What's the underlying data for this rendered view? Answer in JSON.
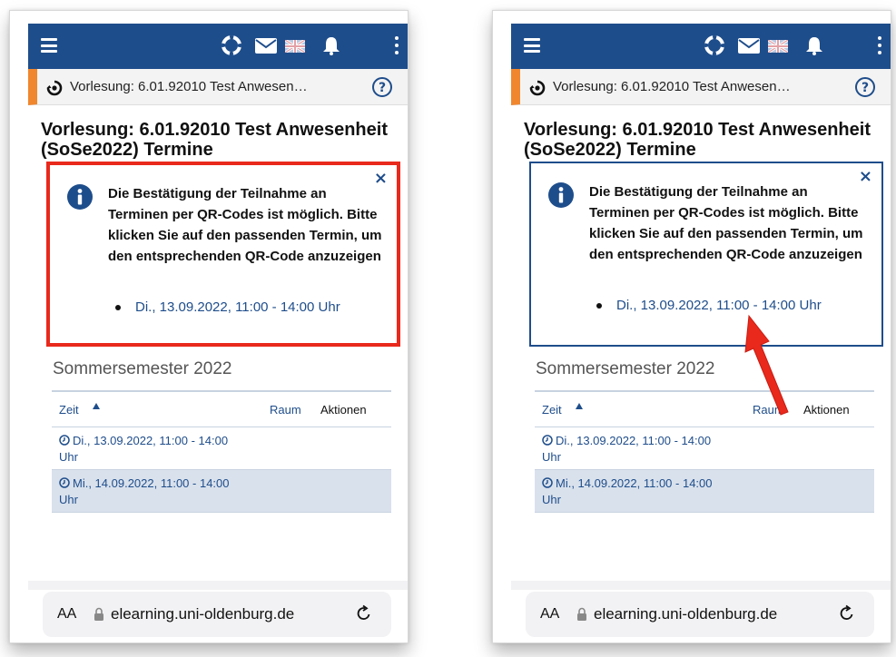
{
  "colors": {
    "brand_blue": "#1e4d8b",
    "accent_orange": "#f0872e",
    "highlight_red": "#e8291c",
    "row_alt": "#d9e1ec"
  },
  "panels": [
    {
      "breadcrumb": "Vorlesung: 6.01.92010 Test Anwesen…",
      "title": "Vorlesung: 6.01.92010 Test Anwesenheit (SoSe2022) Termine",
      "info": {
        "message": "Die Bestätigung der Teilnahme an Terminen per QR-Codes ist möglich. Bitte klicken Sie auf den passenden Termin, um den entsprechenden QR-Code anzuzeigen",
        "appointment": "Di., 13.09.2022, 11:00 - 14:00 Uhr",
        "close": "×"
      },
      "semester": "Sommersemester 2022",
      "table": {
        "headers": {
          "time": "Zeit",
          "room": "Raum",
          "actions": "Aktionen"
        },
        "rows": [
          {
            "time": "Di., 13.09.2022, 11:00 - 14:00 Uhr"
          },
          {
            "time": "Mi., 14.09.2022, 11:00 - 14:00 Uhr"
          }
        ]
      },
      "urlbar": {
        "aa": "AA",
        "domain": "elearning.uni-oldenburg.de"
      }
    },
    {
      "breadcrumb": "Vorlesung: 6.01.92010 Test Anwesen…",
      "title": "Vorlesung: 6.01.92010 Test Anwesenheit (SoSe2022) Termine",
      "info": {
        "message": "Die Bestätigung der Teilnahme an Terminen per QR-Codes ist möglich. Bitte klicken Sie auf den passenden Termin, um den entsprechenden QR-Code anzuzeigen",
        "appointment": "Di., 13.09.2022, 11:00 - 14:00 Uhr",
        "close": "×"
      },
      "semester": "Sommersemester 2022",
      "table": {
        "headers": {
          "time": "Zeit",
          "room": "Raum",
          "actions": "Aktionen"
        },
        "rows": [
          {
            "time": "Di., 13.09.2022, 11:00 - 14:00 Uhr"
          },
          {
            "time": "Mi., 14.09.2022, 11:00 - 14:00 Uhr"
          }
        ]
      },
      "urlbar": {
        "aa": "AA",
        "domain": "elearning.uni-oldenburg.de"
      }
    }
  ]
}
